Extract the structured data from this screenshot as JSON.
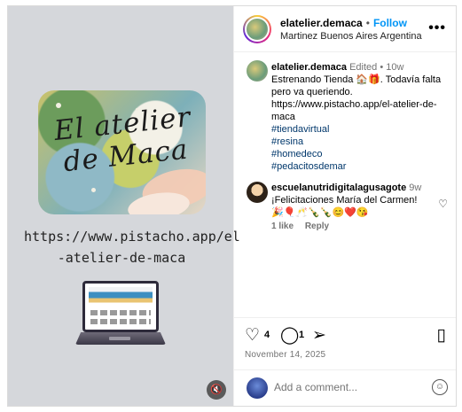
{
  "media": {
    "cover_text": "El atelier de Maca",
    "url_line1": "https://www.pistacho.app/el",
    "url_line2": "-atelier-de-maca",
    "mute_icon": "🔇"
  },
  "header": {
    "username": "elatelier.demaca",
    "follow_label": "Follow",
    "location": "Martinez Buenos Aires Argentina",
    "more_label": "•••"
  },
  "caption": {
    "username": "elatelier.demaca",
    "edited": "Edited",
    "time": "10w",
    "text_line1": "Estrenando Tienda 🏠🎁. Todavía falta",
    "text_line2": "pero va queriendo.",
    "link_line1": "https://www.pistacho.app/el-atelier-de-",
    "link_line2": "maca",
    "hashtags": [
      "#tiendavirtual",
      "#resina",
      "#homedeco",
      "#pedacitosdemar"
    ]
  },
  "comment": {
    "username": "escuelanutridigitalagusagote",
    "time": "9w",
    "text": "¡Felicitaciones María del Carmen!",
    "emojis": "🎉🎈🥂🍾🍾😊❤️😘",
    "likes": "1 like",
    "reply": "Reply"
  },
  "actions": {
    "like_count": "4",
    "comment_count": "1",
    "date": "November 14, 2025"
  },
  "add_comment": {
    "placeholder": "Add a comment..."
  }
}
